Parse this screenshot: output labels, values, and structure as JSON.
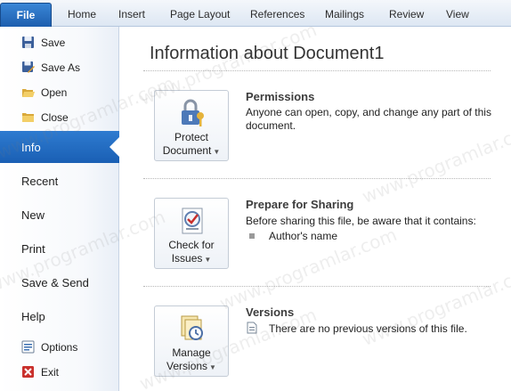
{
  "ribbon": {
    "file_tab": "File",
    "tabs": [
      "Home",
      "Insert",
      "Page Layout",
      "References",
      "Mailings",
      "Review",
      "View"
    ]
  },
  "nav": {
    "commands_top": [
      {
        "label": "Save",
        "icon": "save-icon"
      },
      {
        "label": "Save As",
        "icon": "save-as-icon"
      },
      {
        "label": "Open",
        "icon": "open-folder-icon"
      },
      {
        "label": "Close",
        "icon": "close-folder-icon"
      }
    ],
    "tabs": [
      "Info",
      "Recent",
      "New",
      "Print",
      "Save & Send",
      "Help"
    ],
    "selected_tab": "Info",
    "commands_bottom": [
      {
        "label": "Options",
        "icon": "options-icon"
      },
      {
        "label": "Exit",
        "icon": "exit-icon"
      }
    ]
  },
  "main": {
    "title": "Information about Document1",
    "sections": [
      {
        "button_line1": "Protect",
        "button_line2": "Document",
        "icon": "lock-keys-icon",
        "heading": "Permissions",
        "text": "Anyone can open, copy, and change any part of this document."
      },
      {
        "button_line1": "Check for",
        "button_line2": "Issues",
        "icon": "checklist-icon",
        "heading": "Prepare for Sharing",
        "text": "Before sharing this file, be aware that it contains:",
        "bullet": "Author's name"
      },
      {
        "button_line1": "Manage",
        "button_line2": "Versions",
        "icon": "versions-icon",
        "heading": "Versions",
        "text": "There are no previous versions of this file."
      }
    ]
  },
  "watermark": "www.programlar.com",
  "colors": {
    "accent": "#1f64b8",
    "nav_selected": "#2a72c8"
  }
}
